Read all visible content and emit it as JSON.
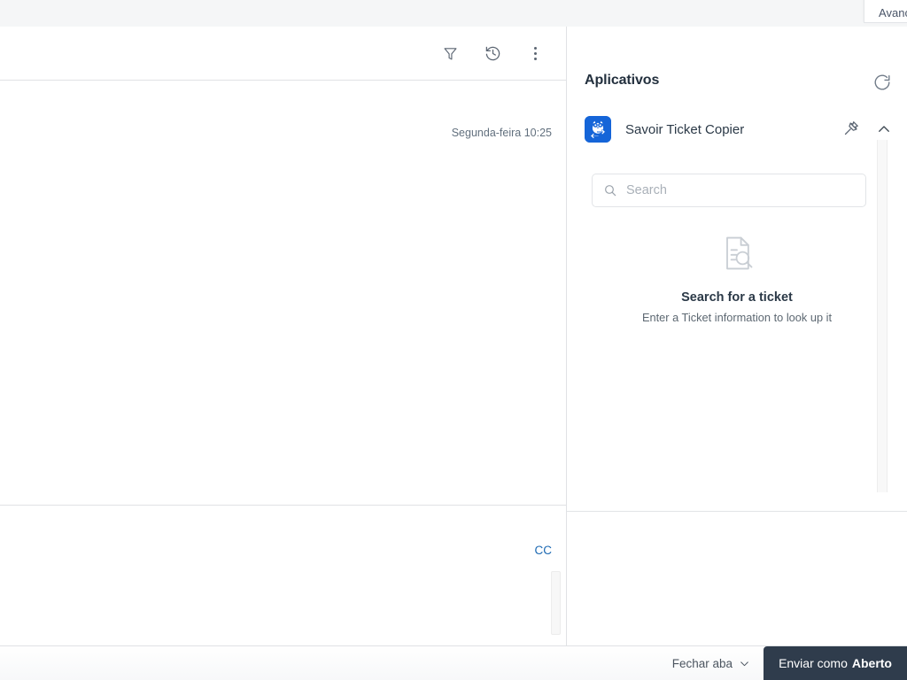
{
  "window": {
    "cut_tab_label": "Avanç"
  },
  "conversation": {
    "timestamp": "Segunda-feira 10:25",
    "toolbar": {
      "filter_icon": "filter-icon",
      "history_icon": "history-icon",
      "more_icon": "more-vertical-icon"
    },
    "composer": {
      "cc_label": "CC"
    }
  },
  "apps_panel": {
    "title": "Aplicativos",
    "refresh_icon": "refresh-icon",
    "app": {
      "name": "Savoir Ticket Copier",
      "icon": "owl-swap-icon",
      "pin_icon": "pin-icon",
      "collapse_icon": "chevron-up-icon"
    },
    "search": {
      "placeholder": "Search",
      "value": "",
      "icon": "search-icon"
    },
    "empty_state": {
      "icon": "document-search-icon",
      "title": "Search for a ticket",
      "subtitle": "Enter a Ticket information to look up it"
    }
  },
  "footer": {
    "close_tab_label": "Fechar aba",
    "close_tab_icon": "chevron-down-icon",
    "send_prefix": "Enviar como ",
    "send_status": "Aberto"
  },
  "colors": {
    "accent_blue": "#1c69b3",
    "app_icon_blue": "#1565d8",
    "send_button_dark": "#2f3c4c"
  }
}
